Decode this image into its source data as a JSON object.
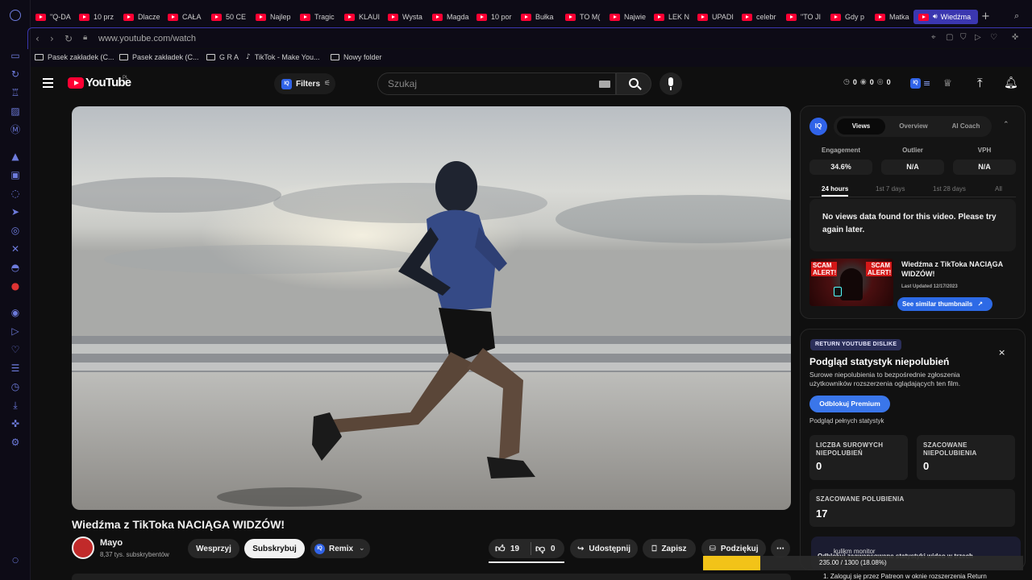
{
  "browser": {
    "tabs": [
      {
        "label": "\"Q-DA"
      },
      {
        "label": "10 prz"
      },
      {
        "label": "Dlacze"
      },
      {
        "label": "CAŁA"
      },
      {
        "label": "50 CE"
      },
      {
        "label": "Najlep"
      },
      {
        "label": "Tragic"
      },
      {
        "label": "KLAUI"
      },
      {
        "label": "Wysta"
      },
      {
        "label": "Magda"
      },
      {
        "label": "10 por"
      },
      {
        "label": "Bułka"
      },
      {
        "label": "TO M("
      },
      {
        "label": "Najwie"
      },
      {
        "label": "LEK N"
      },
      {
        "label": "UPADI"
      },
      {
        "label": "celebr"
      },
      {
        "label": "\"TO JI"
      },
      {
        "label": "Gdy p"
      },
      {
        "label": "Matka"
      },
      {
        "label": "Wiedźma"
      }
    ],
    "url": "www.youtube.com/watch",
    "bookmarks": [
      {
        "label": "Pasek zakładek (C..."
      },
      {
        "label": "Pasek zakładek (C..."
      },
      {
        "label": "G R A"
      },
      {
        "label": "TikTok - Make You..."
      },
      {
        "label": "Nowy folder"
      }
    ]
  },
  "youtube": {
    "logo_text": "YouTube",
    "country_code": "PL",
    "filters_label": "Filters",
    "search_placeholder": "Szukaj",
    "header_counters": [
      "0",
      "0",
      "0"
    ]
  },
  "video": {
    "title": "Wiedźma z TikToka NACIĄGA WIDZÓW!",
    "channel_name": "Mayo",
    "subscribers": "8,37 tys. subskrybentów",
    "support_label": "Wesprzyj",
    "subscribe_label": "Subskrybuj",
    "remix_label": "Remix",
    "likes": "19",
    "dislikes": "0",
    "share_label": "Udostępnij",
    "save_label": "Zapisz",
    "thanks_label": "Podziękuj"
  },
  "vidiq": {
    "tabs": [
      "Views",
      "Overview",
      "AI Coach"
    ],
    "metrics": [
      {
        "label": "Engagement",
        "value": "34.6%"
      },
      {
        "label": "Outlier",
        "value": "N/A"
      },
      {
        "label": "VPH",
        "value": "N/A"
      }
    ],
    "ranges": [
      "24 hours",
      "1st 7 days",
      "1st 28 days",
      "All"
    ],
    "no_data": "No views data found for this video. Please try again later.",
    "thumb_title": "Wiedźma z TikToka NACIĄGA WIDZÓW!",
    "last_updated": "Last Updated 12/17/2023",
    "similar_label": "See similar thumbnails",
    "thumb_text_left": "SCAM ALERT!",
    "thumb_text_right": "SCAM ALERT!"
  },
  "ryd": {
    "badge": "RETURN YOUTUBE DISLIKE",
    "title": "Podgląd statystyk niepolubień",
    "description": "Surowe niepolubienia to bezpośrednie zgłoszenia użytkowników rozszerzenia oglądających ten film.",
    "unlock_label": "Odblokuj Premium",
    "full_stats": "Podgląd pełnych statystyk",
    "raw_label": "LICZBA SUROWYCH NIEPOLUBIEŃ",
    "raw_value": "0",
    "est_dislikes_label": "SZACOWANE NIEPOLUBIENIA",
    "est_dislikes_value": "0",
    "est_likes_label": "SZACOWANE POLUBIENIA",
    "est_likes_value": "17",
    "bottom_text_1": "Odblokuj zaawansowane statystyki wideo w trzech",
    "bottom_text_2": "1. Zaloguj się przez Patreon w oknie rozszerzenia Return",
    "overlay_progress": "235.00 / 1300 (18.08%)",
    "overlay_title": "kulikm monitor"
  },
  "colors": {
    "accent": "#3b37b0",
    "yt_red": "#ff0033",
    "iq_blue": "#3063e8"
  }
}
